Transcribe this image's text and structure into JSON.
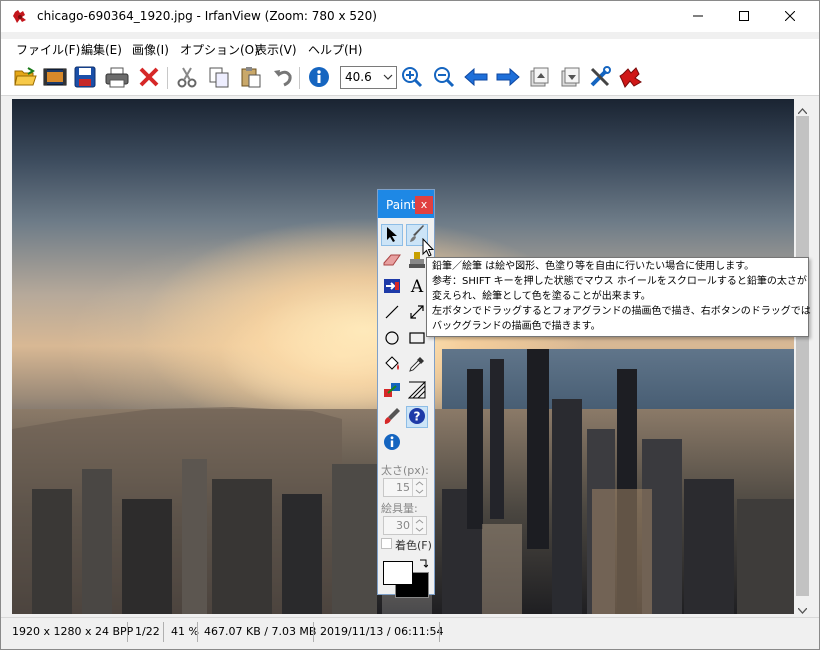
{
  "window": {
    "title": "chicago-690364_1920.jpg - IrfanView (Zoom: 780 x 520)",
    "accent_color": "#1e88e5"
  },
  "menu": {
    "items": [
      "ファイル(F)",
      "編集(E)",
      "画像(I)",
      "オプション(O)",
      "表示(V)",
      "ヘルプ(H)"
    ]
  },
  "toolbar": {
    "zoom_value": "40.6",
    "icons": [
      "open-folder-icon",
      "slideshow-icon",
      "save-icon",
      "print-icon",
      "delete-icon",
      "cut-icon",
      "copy-icon",
      "paste-icon",
      "undo-icon",
      "info-icon",
      "zoom-in-icon",
      "zoom-out-icon",
      "previous-icon",
      "next-icon",
      "first-page-icon",
      "last-page-icon",
      "settings-icon",
      "irfanview-icon"
    ]
  },
  "paint": {
    "title": "Paint",
    "close_label": "x",
    "thickness_label": "太さ(px):",
    "thickness_value": "15",
    "amount_label": "絵具量:",
    "amount_value": "30",
    "colorize_label": "着色(F)",
    "foreground_color": "#ffffff",
    "background_color": "#000000"
  },
  "tooltip": {
    "lines": [
      "鉛筆／絵筆 は絵や図形、色塗り等を自由に行いたい場合に使用します。",
      "参考：SHIFT キーを押した状態でマウス ホイールをスクロールすると鉛筆の太さが",
      "変えられ、絵筆として色を塗ることが出来ます。",
      "左ボタンでドラッグするとフォアグランドの描画色で描き、右ボタンのドラッグでは",
      "バックグランドの描画色で描きます。"
    ]
  },
  "status": {
    "dimensions": "1920 x 1280 x 24 BPP",
    "index": "1/22",
    "zoom": "41 %",
    "size": "467.07 KB / 7.03 MB",
    "datetime": "2019/11/13 / 06:11:54"
  }
}
